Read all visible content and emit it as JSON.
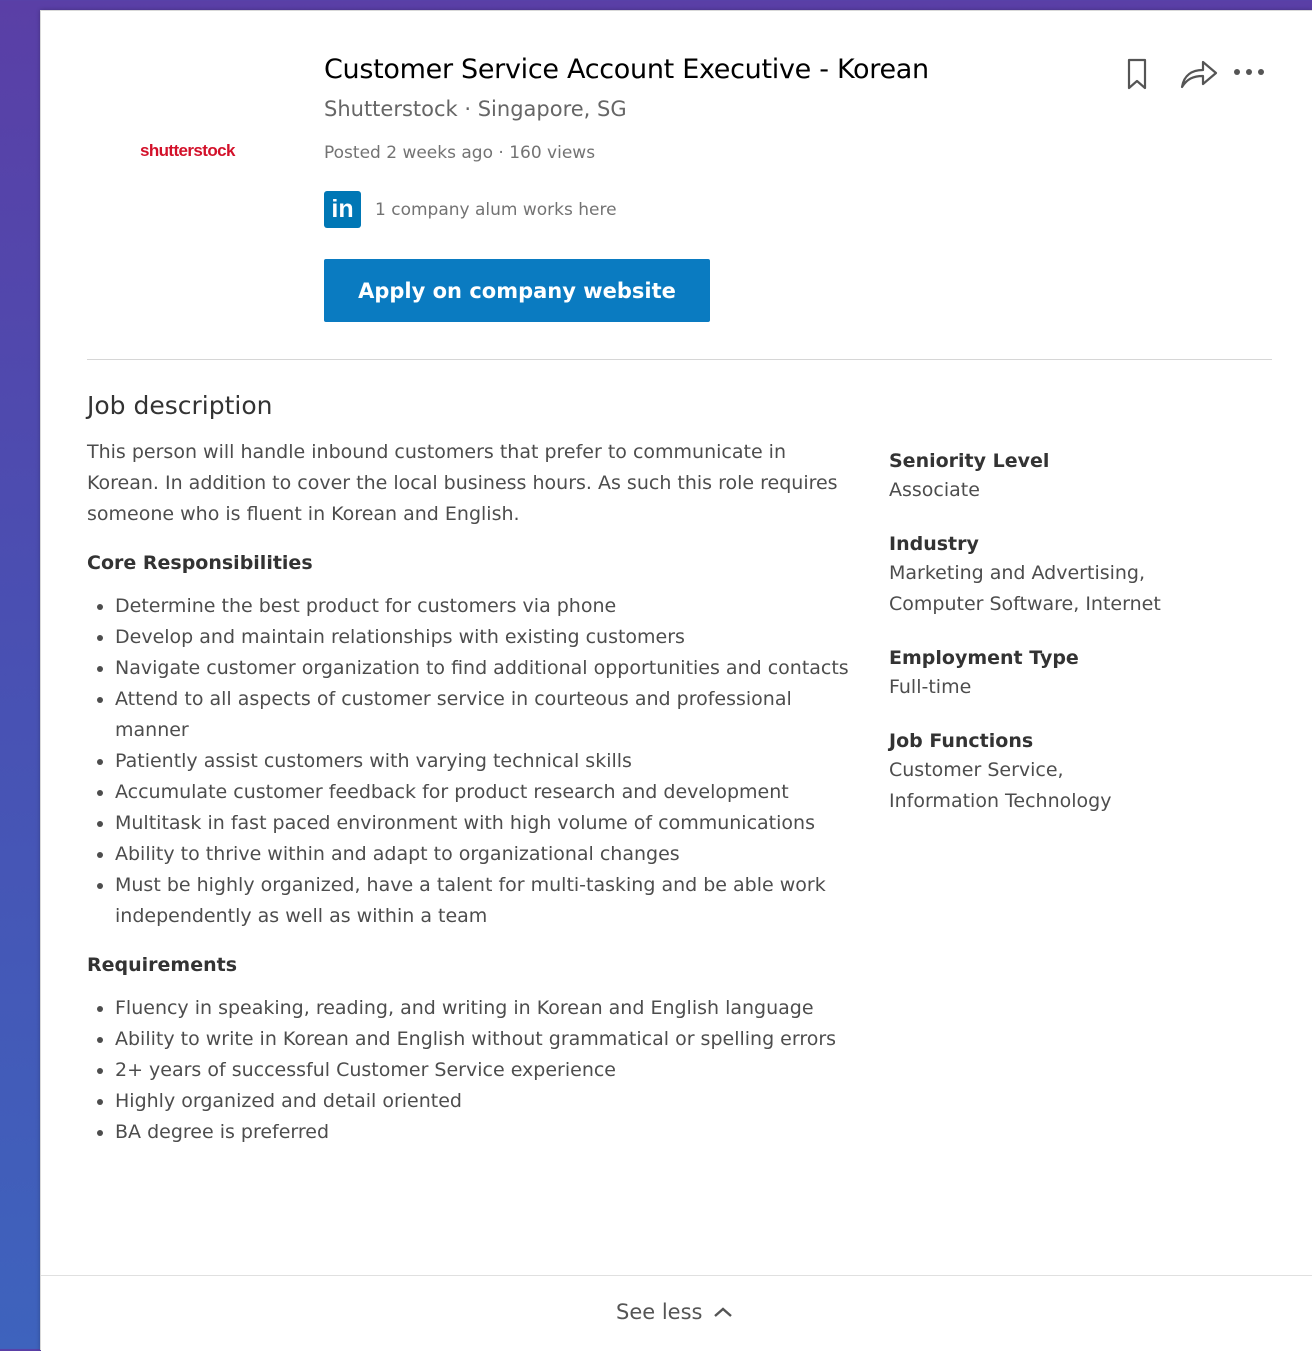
{
  "company": {
    "logo_text": "shutterstock"
  },
  "job": {
    "title": "Customer Service Account Executive - Korean",
    "company_location": "Shutterstock · Singapore, SG",
    "meta": "Posted 2 weeks ago · 160 views",
    "alum_badge": "in",
    "alum_text": "1 company alum works here",
    "apply_label": "Apply on company website"
  },
  "actions": {
    "icons": [
      "bookmark-icon",
      "share-icon",
      "more-icon"
    ]
  },
  "description": {
    "heading": "Job description",
    "intro": "This person will handle inbound customers that prefer to communicate in Korean. In addition to cover the local business hours. As such this role requires someone who is fluent in Korean and English.",
    "responsibilities_heading": "Core Responsibilities",
    "responsibilities": [
      "Determine the best product for customers via phone",
      "Develop and maintain relationships with existing customers",
      "Navigate customer organization to find additional opportunities and contacts",
      "Attend to all aspects of customer service in courteous and professional manner",
      "Patiently assist customers with varying technical skills",
      "Accumulate customer feedback for product research and development",
      "Multitask in fast paced environment with high volume of communications",
      "Ability to thrive within and adapt to organizational changes",
      "Must be highly organized, have a talent for multi-tasking and be able work independently as well as within a team"
    ],
    "requirements_heading": "Requirements",
    "requirements": [
      "Fluency in speaking, reading, and writing in Korean and English language",
      "Ability to write in Korean and English without grammatical or spelling errors",
      "2+ years of successful Customer Service experience",
      "Highly organized and detail oriented",
      "BA degree is preferred"
    ]
  },
  "criteria": [
    {
      "label": "Seniority Level",
      "value": "Associate"
    },
    {
      "label": "Industry",
      "value": "Marketing and Advertising, Computer Software, Internet"
    },
    {
      "label": "Employment Type",
      "value": "Full-time"
    },
    {
      "label": "Job Functions",
      "value": "Customer Service, Information Technology"
    }
  ],
  "footer": {
    "see_less_label": "See less"
  },
  "colors": {
    "brand": "#0a7bc1",
    "logo_red": "#d3112a",
    "linkedin_blue": "#0077b5"
  }
}
